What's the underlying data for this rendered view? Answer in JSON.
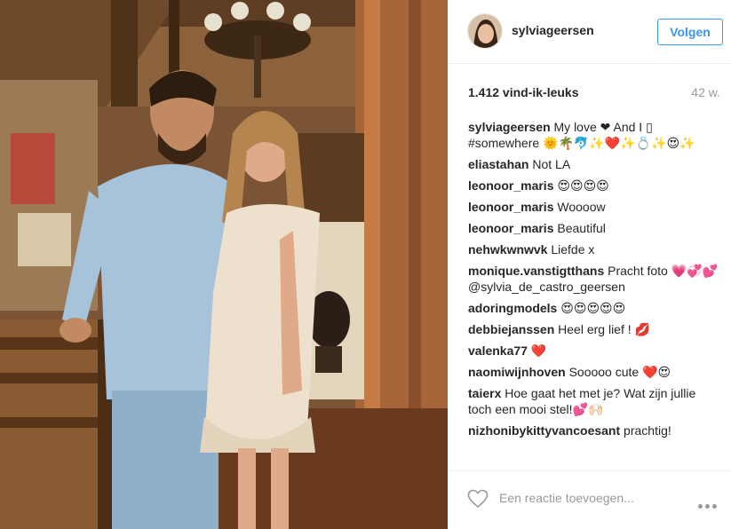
{
  "post": {
    "username": "sylviageersen",
    "follow_label": "Volgen",
    "likes": "1.412 vind-ik-leuks",
    "time": "42 w."
  },
  "comments": [
    {
      "user": "sylviageersen",
      "text": "My love ❤ And I ▯ #somewhere 🌞🌴🐬✨❤️✨💍✨😍✨"
    },
    {
      "user": "eliastahan",
      "text": "Not LA"
    },
    {
      "user": "leonoor_maris",
      "text": "😍😍😍😍"
    },
    {
      "user": "leonoor_maris",
      "text": "Woooow"
    },
    {
      "user": "leonoor_maris",
      "text": "Beautiful"
    },
    {
      "user": "nehwkwnwvk",
      "text": "Liefde x"
    },
    {
      "user": "monique.vanstigtthans",
      "text": "Pracht foto 💗💞💕 @sylvia_de_castro_geersen"
    },
    {
      "user": "adoringmodels",
      "text": "😍😍😍😍😍"
    },
    {
      "user": "debbiejanssen",
      "text": "Heel erg lief ! 💋"
    },
    {
      "user": "valenka77",
      "text": "❤️"
    },
    {
      "user": "naomiwijnhoven",
      "text": "Sooooo cute ❤️😍"
    },
    {
      "user": "taierx",
      "text": "Hoe gaat het met je? Wat zijn jullie toch een mooi stel!💕🙌🏻"
    },
    {
      "user": "nizhonibykittyvancoesant",
      "text": "prachtig!"
    }
  ],
  "footer": {
    "comment_placeholder": "Een reactie toevoegen...",
    "like_icon": "heart-outline-icon",
    "more_icon": "more-options-icon"
  }
}
